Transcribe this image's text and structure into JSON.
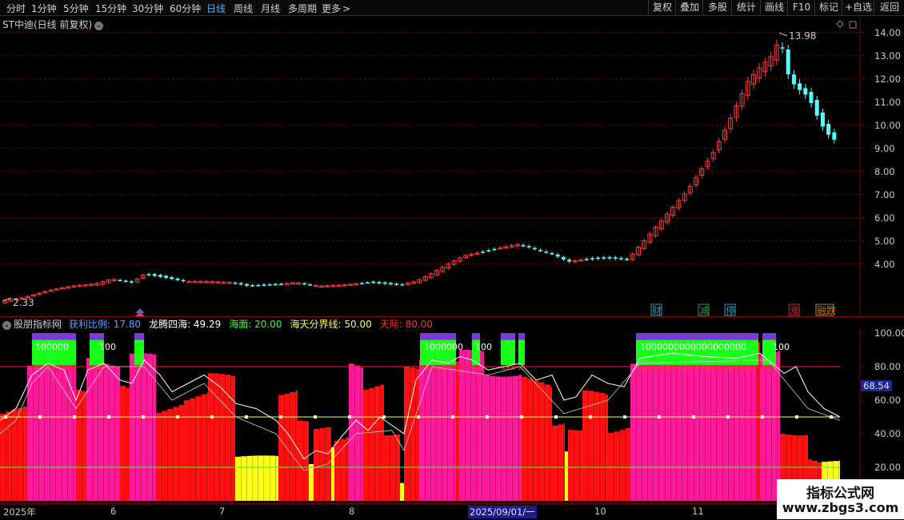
{
  "toolbar": {
    "periods": [
      "分时",
      "1分钟",
      "5分钟",
      "15分钟",
      "30分钟",
      "60分钟",
      "日线",
      "周线",
      "月线",
      "多周期",
      "更多"
    ],
    "active_period": "日线",
    "more_arrow": ">",
    "right_buttons": [
      "复权",
      "叠加",
      "多股",
      "统计",
      "画线",
      "F10",
      "标记",
      "+自选",
      "返回"
    ]
  },
  "main_chart": {
    "title": "ST中迪(日线 前复权)",
    "circle_icon": "chevron-down-icon",
    "y_ticks": [
      "14.00",
      "13.00",
      "12.00",
      "11.00",
      "10.00",
      "9.00",
      "8.00",
      "7.00",
      "6.00",
      "5.00",
      "4.00"
    ],
    "high_label": "13.98",
    "low_label": "2.33",
    "event_markers": [
      "财",
      "减",
      "停",
      "涨",
      "融跌"
    ],
    "colors": {
      "up": "#ff3b3b",
      "down": "#54ffff",
      "grid": "#7a0000"
    }
  },
  "indicator": {
    "name": "股朋指标网",
    "items": [
      {
        "label": "获利比例:",
        "value": "17.80",
        "color": "#5aa0ff"
      },
      {
        "label": "龙腾四海:",
        "value": "49.29",
        "color": "#ffffff"
      },
      {
        "label": "海面:",
        "value": "20.00",
        "color": "#33ff33"
      },
      {
        "label": "海天分界线:",
        "value": "50.00",
        "color": "#ffff55"
      },
      {
        "label": "天际:",
        "value": "80.00",
        "color": "#ff3333"
      }
    ],
    "y_ticks": [
      "100.00",
      "80.00",
      "60.00",
      "40.00",
      "20.00"
    ],
    "current_value": "68.54",
    "peak_labels": [
      "100000",
      "100",
      "1000000",
      "100",
      "1000000000000000000",
      "100"
    ],
    "colors": {
      "red": "#ff1010",
      "magenta": "#ff1a9a",
      "yellow": "#ffff1a",
      "green": "#1aff1a",
      "purple": "#7a3ad8"
    }
  },
  "date_axis": {
    "labels": [
      "2025年",
      "6",
      "7",
      "8",
      "2025/09/01/一",
      "10",
      "11"
    ]
  },
  "watermark": {
    "title": "指标公式网",
    "url": "www.zbgs3.com"
  }
}
